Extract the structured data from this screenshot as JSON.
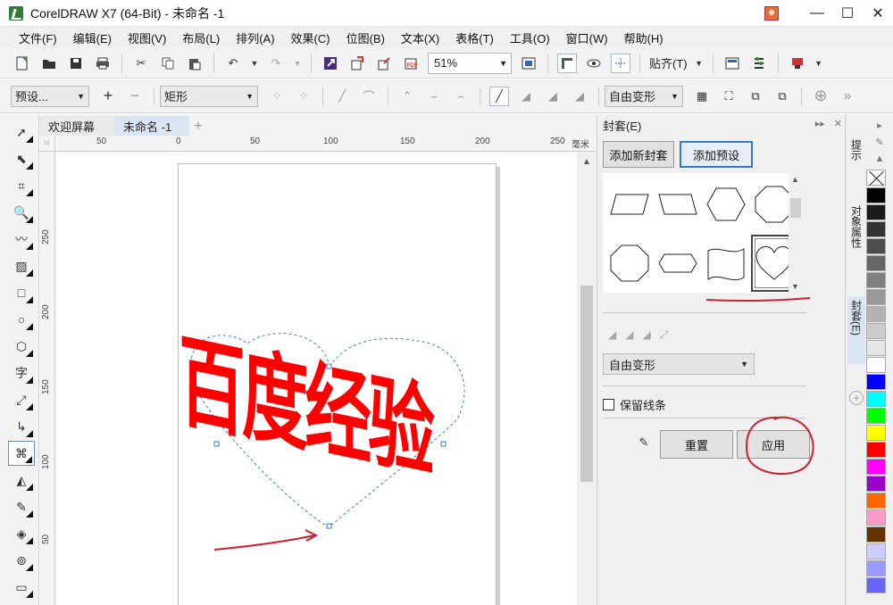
{
  "window": {
    "title": "CorelDRAW X7 (64-Bit) - 未命名 -1",
    "controls": {
      "minimize": "—",
      "maximize": "☐",
      "close": "✕"
    }
  },
  "menubar": {
    "items": [
      "文件(F)",
      "编辑(E)",
      "视图(V)",
      "布局(L)",
      "排列(A)",
      "效果(C)",
      "位图(B)",
      "文本(X)",
      "表格(T)",
      "工具(O)",
      "窗口(W)",
      "帮助(H)"
    ]
  },
  "toolbar": {
    "zoom": "51%",
    "snap_label": "贴齐(T)"
  },
  "propertybar": {
    "preset_combo": "预设...",
    "shape_combo": "矩形",
    "transform_combo": "自由变形"
  },
  "tabs": {
    "welcome": "欢迎屏幕",
    "document": "未命名 -1",
    "add": "+"
  },
  "ruler": {
    "h_labels": [
      "50",
      "0",
      "50",
      "100",
      "150",
      "200",
      "250"
    ],
    "unit": "毫米",
    "v_labels": [
      "250",
      "200",
      "150",
      "100",
      "50"
    ]
  },
  "canvas": {
    "text": "百度经验",
    "text_color": "#ff0000",
    "envelope_color": "#3a7bd5",
    "annotation_color": "#cc1f2f"
  },
  "docker": {
    "title": "封套(E)",
    "add_new_envelope": "添加新封套",
    "add_preset": "添加预设",
    "presets": [
      "parallelogram-right",
      "parallelogram-left",
      "hexagon",
      "octagon",
      "octagon",
      "elongated-hexagon",
      "flag",
      "heart"
    ],
    "mode_select": "自由变形",
    "keep_lines": "保留线条",
    "reset": "重置",
    "apply": "应用"
  },
  "sidetabs": {
    "hints": "提示",
    "properties": "对象属性",
    "envelope": "封套(E)"
  },
  "palette": {
    "colors": [
      "#000000",
      "#1a1a1a",
      "#333333",
      "#4d4d4d",
      "#666666",
      "#808080",
      "#999999",
      "#b3b3b3",
      "#cccccc",
      "#e6e6e6",
      "#ffffff",
      "#0000ff",
      "#00ffff",
      "#00ff00",
      "#ffff00",
      "#ff0000",
      "#ff00ff",
      "#9900cc",
      "#ff6600",
      "#ff99cc",
      "#663300",
      "#ccccff",
      "#9999ff",
      "#6666ff"
    ]
  }
}
